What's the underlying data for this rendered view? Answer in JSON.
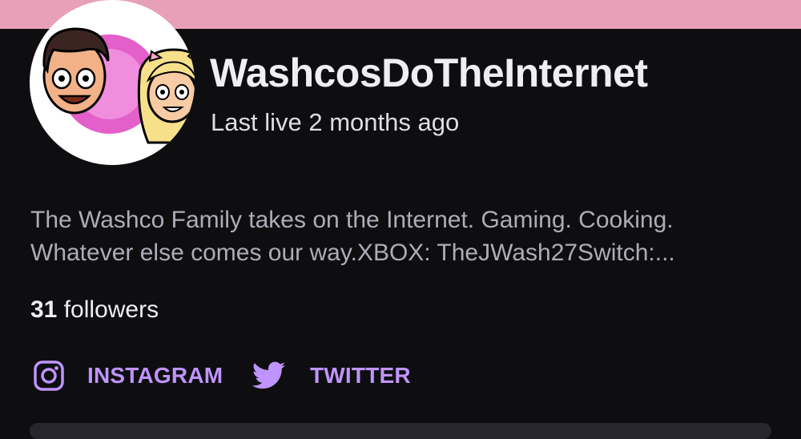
{
  "header": {
    "banner_color": "#e8a0b8"
  },
  "channel": {
    "avatar_icon": "family-cartoon-avatar",
    "name": "WashcosDoTheInternet",
    "last_live": "Last live 2 months ago",
    "description_lines": [
      "The Washco Family takes on the Internet. Gaming. Cooking.",
      "Whatever else comes our way.XBOX: TheJWash27Switch:..."
    ],
    "followers_count": "31",
    "followers_label": "followers"
  },
  "social": {
    "accent_color": "#bf94ff",
    "links": [
      {
        "icon": "instagram-icon",
        "label": "INSTAGRAM"
      },
      {
        "icon": "twitter-icon",
        "label": "TWITTER"
      }
    ]
  }
}
